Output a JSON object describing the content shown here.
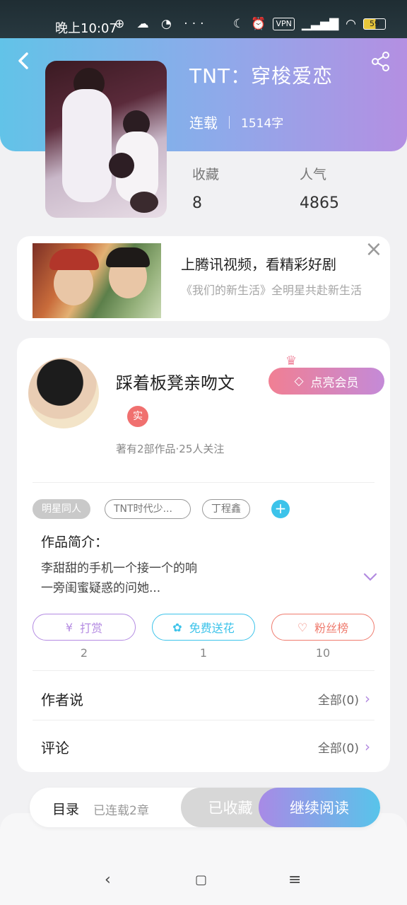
{
  "status_bar": {
    "time": "晚上10:07",
    "left_icons": "⊕ ☁ ◔ ···",
    "vpn": "VPN",
    "battery": "59",
    "icons": [
      "globe-icon",
      "cloud-icon",
      "bulb-icon",
      "more-icon",
      "moon-icon",
      "alarm-icon",
      "signal-icon",
      "wifi-icon",
      "battery-icon"
    ]
  },
  "book": {
    "title": "TNT：穿梭爱恋",
    "status": "连载",
    "word_count": "1514字",
    "stats": [
      {
        "label": "收藏",
        "value": "8"
      },
      {
        "label": "人气",
        "value": "4865"
      }
    ]
  },
  "ad": {
    "headline": "上腾讯视频，看精彩好剧",
    "description": "《我们的新生活》全明星共赴新生活"
  },
  "author": {
    "name": "踩着板凳亲吻文",
    "badge": "实",
    "stats": "著有2部作品·25人关注",
    "vip_button": "点亮会员"
  },
  "tags": [
    "明星同人",
    "TNT时代少...",
    "丁程鑫"
  ],
  "intro": {
    "label": "作品简介：",
    "line1": "李甜甜的手机一个接一个的响",
    "line2": "一旁闺蜜疑惑的问她..."
  },
  "actions": [
    {
      "label": "打赏",
      "count": "2",
      "color": "#b48be2"
    },
    {
      "label": "免费送花",
      "count": "1",
      "color": "#3cc3ea"
    },
    {
      "label": "粉丝榜",
      "count": "10",
      "color": "#ef7b6e"
    }
  ],
  "rows": [
    {
      "label": "作者说",
      "value": "全部(0)"
    },
    {
      "label": "评论",
      "value": "全部(0)"
    }
  ],
  "bottom_bar": {
    "toc": "目录",
    "chapters": "已连载2章",
    "collected": "已收藏",
    "continue": "继续阅读"
  },
  "system_nav": [
    "back",
    "home",
    "menu"
  ]
}
